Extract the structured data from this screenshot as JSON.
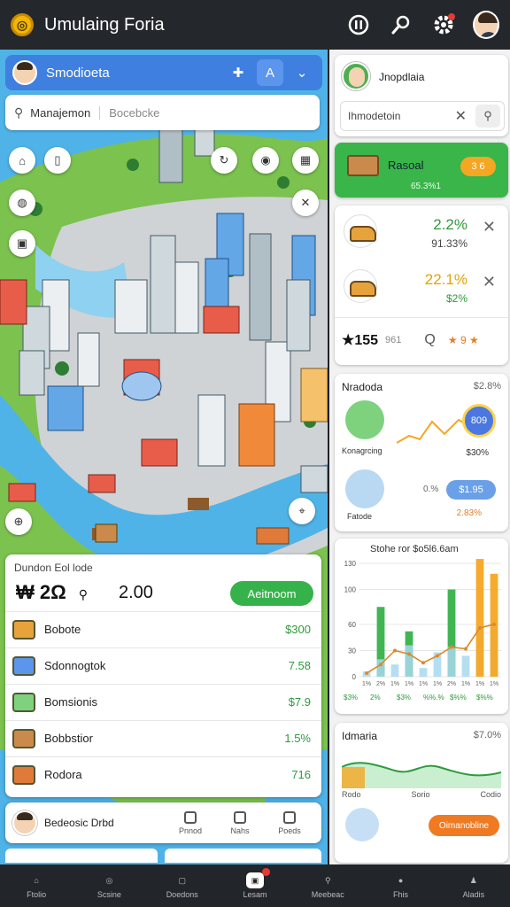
{
  "app": {
    "title": "Umulaing Foria",
    "logo_glyph": "◎"
  },
  "topbar": {
    "icons": [
      "notification-icon",
      "search-icon",
      "gear-icon"
    ]
  },
  "map_panel": {
    "title": "Smodioeta",
    "search_left": "Manajemon",
    "search_right": "Bocebcke"
  },
  "ledger": {
    "title": "Dundon Eol lode",
    "stat_main": "₩ 2Ω",
    "stat_secondary": "2.00",
    "action_label": "Aeitnoom",
    "rows": [
      {
        "label": "Bobote",
        "value": "$300",
        "icon_color": "#e6a33c"
      },
      {
        "label": "Sdonnogtok",
        "value": "7.58",
        "icon_color": "#5b95ec"
      },
      {
        "label": "Bomsionis",
        "value": "$7.9",
        "icon_color": "#7ed27e"
      },
      {
        "label": "Bobbstior",
        "value": "1.5%",
        "icon_color": "#c98a4b"
      },
      {
        "label": "Rodora",
        "value": "716",
        "icon_color": "#e07a3a"
      }
    ]
  },
  "lower_strip": {
    "title": "Bedeosic Drbd",
    "tools": [
      {
        "label": "Pnnod"
      },
      {
        "label": "Nahs"
      },
      {
        "label": "Poeds"
      }
    ]
  },
  "profile_card": {
    "name": "Jnopdlaia",
    "field": "Ihmodetoin"
  },
  "green_card": {
    "title": "Rasoal",
    "badge": "3 6",
    "sub": "65.3%1"
  },
  "trade_card": {
    "rows": [
      {
        "v1": "2.2%",
        "v2": "91.33%"
      },
      {
        "v1": "22.1%",
        "v2": "$2%"
      }
    ],
    "foot": {
      "a": "★155",
      "b": "961",
      "c": "Q",
      "d": "★ 9 ★"
    }
  },
  "stats_card": {
    "head": "Nradoda",
    "head2": "$2.8%",
    "label1": "Konagrcing",
    "label2": "Fatode",
    "pill1": "809",
    "value1": "$30%",
    "pill2": "$1.95",
    "value2": "2.83%",
    "value3": "0.%"
  },
  "chart_card": {
    "title": "Stohe ror $o5l6.6am"
  },
  "chart_data": {
    "type": "bar",
    "categories": [
      "$3%",
      "2%",
      "$3%",
      "%%.%",
      "$%%",
      "$%%"
    ],
    "x_tick_labels": [
      "1%",
      "2%",
      "1%",
      "1%",
      "1%",
      "1%",
      "2%",
      "1%",
      "1%",
      "1%"
    ],
    "series": [
      {
        "values": [
          0,
          80,
          0,
          52,
          0,
          0,
          100,
          0,
          0,
          0
        ]
      },
      {
        "values": [
          6,
          20,
          14,
          36,
          10,
          28,
          34,
          24,
          56,
          54
        ]
      },
      {
        "values": [
          0,
          0,
          0,
          0,
          0,
          0,
          0,
          0,
          135,
          118
        ]
      },
      {
        "values": [
          4,
          14,
          30,
          26,
          16,
          24,
          34,
          32,
          56,
          60
        ]
      }
    ],
    "y_ticks": [
      "0",
      "30",
      "60",
      "100",
      "130"
    ],
    "ylim": [
      0,
      130
    ]
  },
  "sun_card": {
    "head": "Idmaria",
    "head2": "$7.0%",
    "x_labels": [
      "Rodo",
      "Sorio",
      "Codio"
    ],
    "button": "Oimanobline"
  },
  "bottom_nav": {
    "items": [
      {
        "label": "Ftolio",
        "icon": "home-icon"
      },
      {
        "label": "Scsine",
        "icon": "globe-icon"
      },
      {
        "label": "Doedons",
        "icon": "tablet-icon"
      },
      {
        "label": "Lesam",
        "icon": "briefcase-icon",
        "active": true
      },
      {
        "label": "Meebeac",
        "icon": "search-icon"
      },
      {
        "label": "Fhis",
        "icon": "circle-icon"
      },
      {
        "label": "Aladis",
        "icon": "user-icon"
      }
    ]
  }
}
